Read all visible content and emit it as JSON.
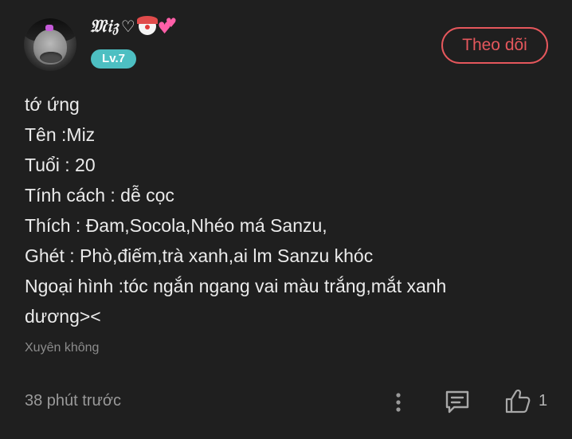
{
  "post": {
    "author": {
      "name": "𝔐𝔦𝔷",
      "heart_glyph": "♡",
      "hearts_glyph": "💕",
      "level": "Lv.7"
    },
    "follow_label": "Theo dõi",
    "content_lines": [
      "tớ ứng",
      "Tên :Miz",
      "Tuổi : 20",
      "Tính cách : dễ cọc",
      "Thích : Đam,Socola,Nhéo má Sanzu,",
      "Ghét : Phò,điếm,trà xanh,ai lm Sanzu khóc",
      "Ngoại hình :tóc ngắn ngang vai màu trắng,mắt xanh",
      "dương><"
    ],
    "topic": "Xuyên không",
    "time": "38 phút trước",
    "like_count": "1"
  },
  "colors": {
    "background": "#1f1f1f",
    "accent_follow": "#e5575c",
    "level_badge": "#4dbfc2",
    "muted_text": "#9a9a9a"
  },
  "icons": {
    "more": "more-vertical-icon",
    "comment": "comment-icon",
    "like": "thumbs-up-icon"
  }
}
